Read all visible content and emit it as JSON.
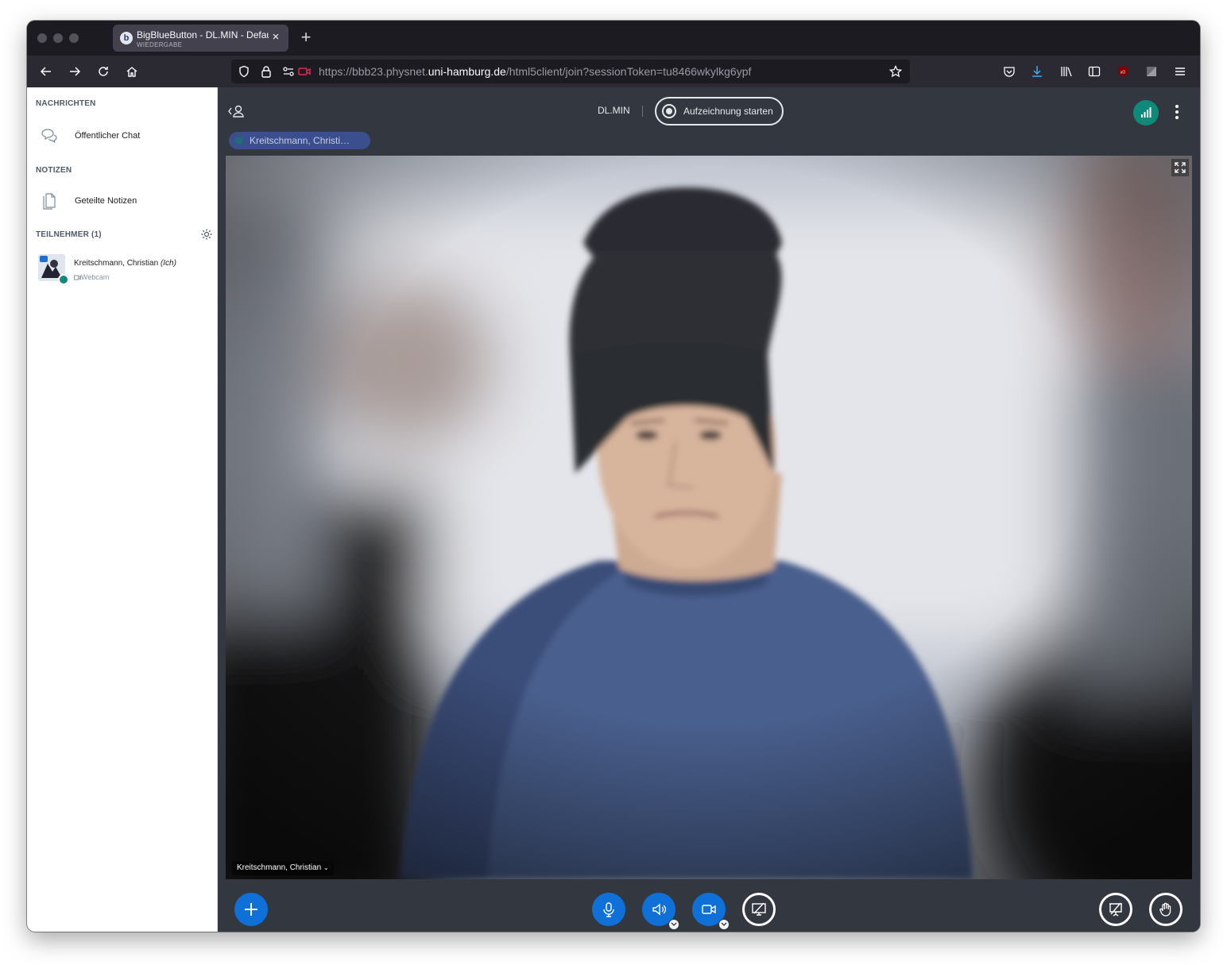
{
  "browser": {
    "tab_title": "BigBlueButton - DL.MIN - Default",
    "tab_subtitle": "WIEDERGABE",
    "tab_favicon": "b",
    "url_prefix": "https://bbb23.physnet.",
    "url_host": "uni-hamburg.de",
    "url_path": "/html5client/join?sessionToken=tu8466wkylkg6ypf"
  },
  "sidebar": {
    "messages_header": "NACHRICHTEN",
    "public_chat": "Öffentlicher Chat",
    "notes_header": "NOTIZEN",
    "shared_notes": "Geteilte Notizen",
    "participants_header": "TEILNEHMER (1)",
    "user": {
      "name": "Kreitschmann, Christian",
      "me_suffix": "(Ich)",
      "status": "Webcam"
    }
  },
  "main": {
    "meeting_name": "DL.MIN",
    "record_label": "Aufzeichnung starten",
    "talking_indicator": "Kreitschmann, Christi…",
    "video_label": "Kreitschmann, Christian"
  },
  "colors": {
    "accent_blue": "#0f70d7",
    "connection_green": "#0f8a7a",
    "app_background": "#333840"
  }
}
